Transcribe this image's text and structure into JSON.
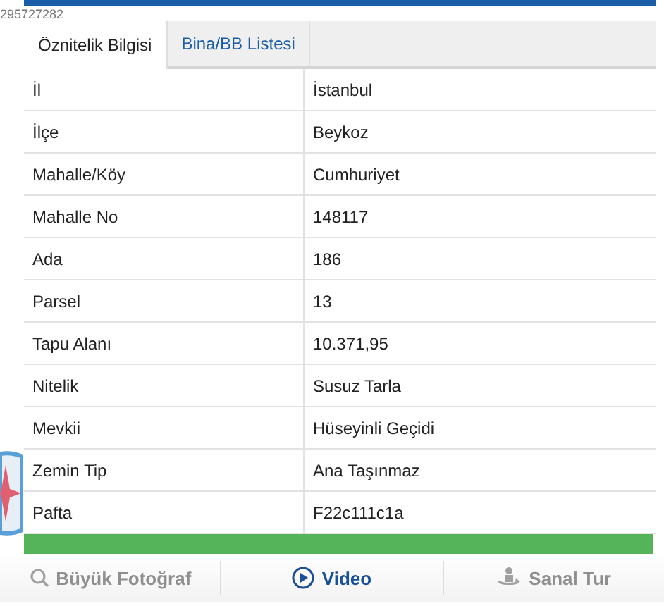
{
  "overlay_code": "295727282",
  "tabs": [
    {
      "label": "Öznitelik Bilgisi",
      "selected": true
    },
    {
      "label": "Bina/BB Listesi",
      "selected": false
    }
  ],
  "rows": [
    {
      "label": "İl",
      "value": "İstanbul"
    },
    {
      "label": "İlçe",
      "value": "Beykoz"
    },
    {
      "label": "Mahalle/Köy",
      "value": "Cumhuriyet"
    },
    {
      "label": "Mahalle No",
      "value": "148117"
    },
    {
      "label": "Ada",
      "value": "186"
    },
    {
      "label": "Parsel",
      "value": "13"
    },
    {
      "label": "Tapu Alanı",
      "value": "10.371,95"
    },
    {
      "label": "Nitelik",
      "value": "Susuz Tarla"
    },
    {
      "label": "Mevkii",
      "value": "Hüseyinli Geçidi"
    },
    {
      "label": "Zemin Tip",
      "value": "Ana Taşınmaz"
    },
    {
      "label": "Pafta",
      "value": "F22c111c1a"
    }
  ],
  "actions": [
    {
      "kind": "photo",
      "label": "Büyük Fotoğraf",
      "disabled": true
    },
    {
      "kind": "video",
      "label": "Video",
      "disabled": false
    },
    {
      "kind": "tour",
      "label": "Sanal Tur",
      "disabled": true
    }
  ]
}
